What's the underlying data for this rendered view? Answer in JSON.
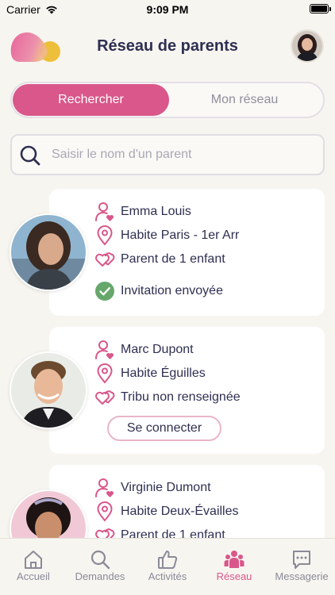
{
  "status_bar": {
    "carrier": "Carrier",
    "time": "9:09 PM"
  },
  "header": {
    "title": "Réseau de parents",
    "logo_icon": "brand-logo",
    "avatar_icon": "user-avatar"
  },
  "segment": {
    "active_label": "Rechercher",
    "inactive_label": "Mon réseau"
  },
  "search": {
    "placeholder": "Saisir le nom d'un parent",
    "value": ""
  },
  "colors": {
    "accent": "#d9578a",
    "title": "#2e2f52",
    "background": "#f7f5f0",
    "success": "#66a86b"
  },
  "parents": [
    {
      "name": "Emma Louis",
      "location": "Habite Paris - 1er Arr",
      "family": "Parent de 1 enfant",
      "status": "Invitation envoyée",
      "status_icon": "check-circle-icon"
    },
    {
      "name": "Marc Dupont",
      "location": "Habite Éguilles",
      "family": "Tribu non renseignée",
      "action": "Se connecter"
    },
    {
      "name": "Virginie Dumont",
      "location": "Habite Deux-Évailles",
      "family": "Parent de 1 enfant"
    }
  ],
  "tabbar": [
    {
      "label": "Accueil",
      "icon": "home-icon",
      "active": false
    },
    {
      "label": "Demandes",
      "icon": "search-icon",
      "active": false
    },
    {
      "label": "Activités",
      "icon": "thumbs-up-icon",
      "active": false
    },
    {
      "label": "Réseau",
      "icon": "group-icon",
      "active": true
    },
    {
      "label": "Messagerie",
      "icon": "chat-icon",
      "active": false
    }
  ]
}
